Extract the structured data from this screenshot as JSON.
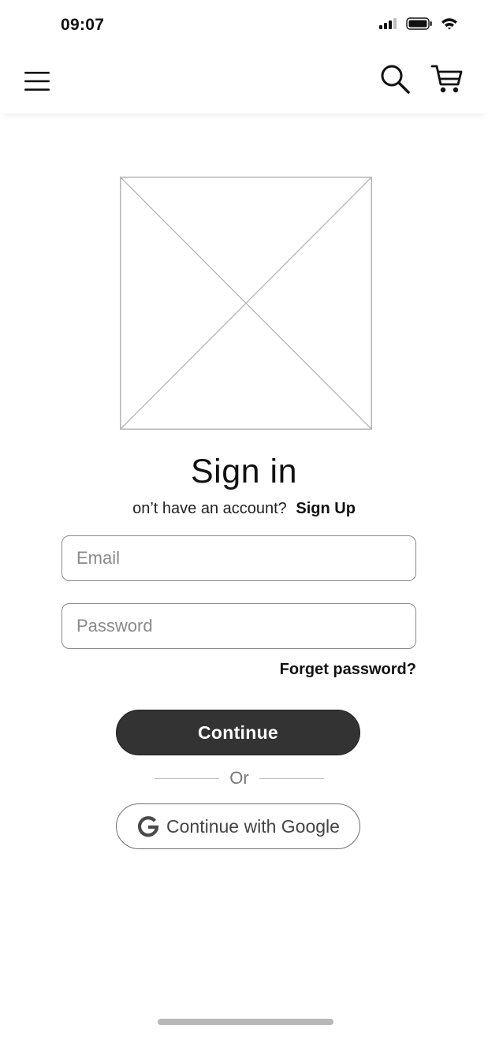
{
  "status_bar": {
    "time": "09:07",
    "icons": [
      "signal-icon",
      "battery-icon",
      "wifi-icon"
    ]
  },
  "header": {
    "menu_icon": "hamburger-menu-icon",
    "search_icon": "search-icon",
    "cart_icon": "shopping-cart-icon"
  },
  "hero": {
    "image": "image-placeholder"
  },
  "signin": {
    "title": "Sign in",
    "account_prompt": "on’t have an account?",
    "signup_label": "Sign Up",
    "email_placeholder": "Email",
    "password_placeholder": "Password",
    "forgot_label": "Forget password?",
    "continue_label": "Continue",
    "or_label": "Or",
    "google_label": "Continue with Google"
  },
  "colors": {
    "primary_button": "#333333",
    "border": "#8a8a8a",
    "placeholder_text": "#8a8a8a",
    "home_indicator": "#b8b8b8"
  }
}
